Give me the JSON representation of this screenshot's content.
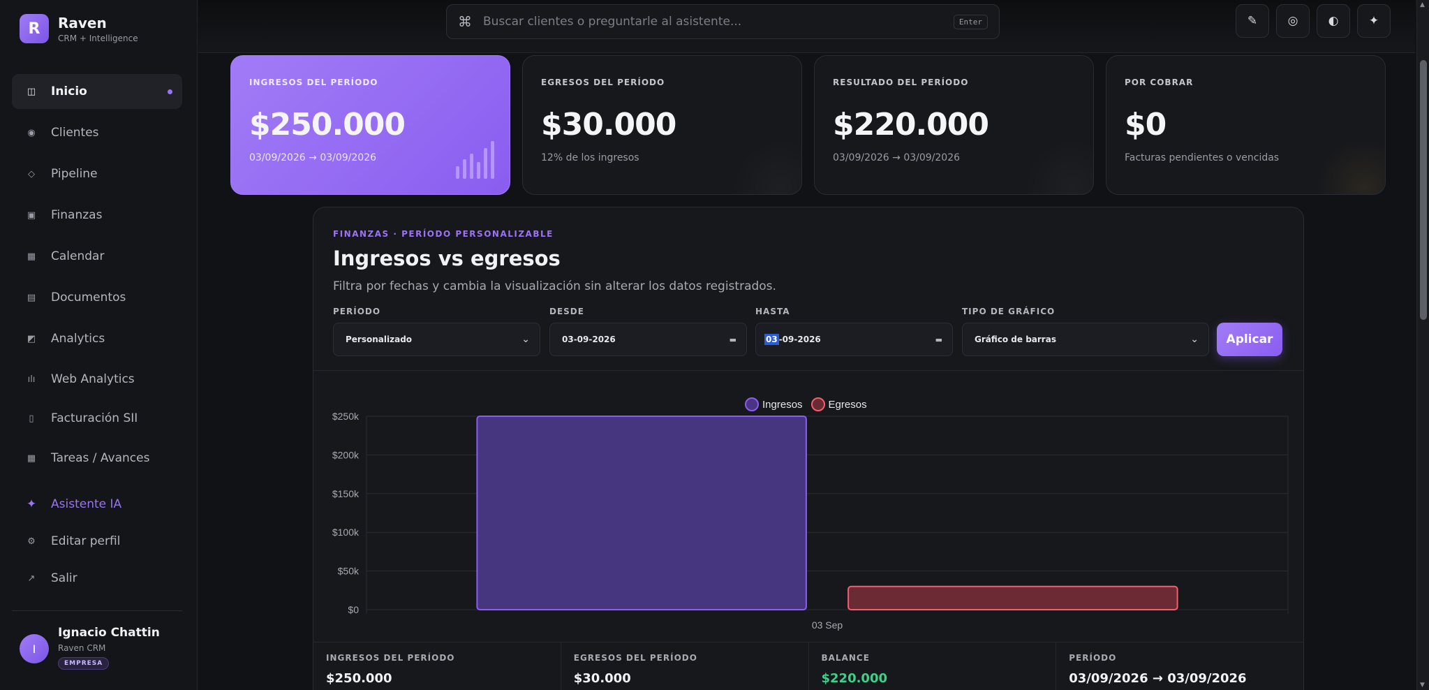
{
  "brand": {
    "initial": "R",
    "name": "Raven",
    "subtitle": "CRM + Intelligence"
  },
  "search": {
    "icon": "command-icon",
    "placeholder": "Buscar clientes o preguntarle al asistente...",
    "shortcut": "Enter"
  },
  "toolbar": {
    "buttons": [
      "edit-icon",
      "target-icon",
      "contrast-icon",
      "sparkle-icon"
    ]
  },
  "nav": {
    "items": [
      {
        "label": "Inicio",
        "icon": "layout-icon",
        "active": true
      },
      {
        "label": "Clientes",
        "icon": "users-icon"
      },
      {
        "label": "Pipeline",
        "icon": "diamond-icon"
      },
      {
        "label": "Finanzas",
        "icon": "wallet-icon"
      },
      {
        "label": "Calendar",
        "icon": "calendar-icon"
      },
      {
        "label": "Documentos",
        "icon": "documents-icon"
      },
      {
        "label": "Analytics",
        "icon": "analytics-icon"
      },
      {
        "label": "Web Analytics",
        "icon": "bar-chart-icon"
      },
      {
        "label": "Facturación SII",
        "icon": "invoice-icon"
      },
      {
        "label": "Tareas / Avances",
        "icon": "tasks-icon"
      }
    ],
    "assistant": "Asistente IA",
    "edit_profile": "Editar perfil",
    "logout": "Salir"
  },
  "user": {
    "initial": "I",
    "name": "Ignacio Chattin",
    "org": "Raven CRM",
    "badge": "EMPRESA"
  },
  "kpis": [
    {
      "label": "INGRESOS DEL PERÍODO",
      "value": "$250.000",
      "sub": "03/09/2026 → 03/09/2026"
    },
    {
      "label": "EGRESOS DEL PERÍODO",
      "value": "$30.000",
      "sub": "12% de los ingresos"
    },
    {
      "label": "RESULTADO DEL PERÍODO",
      "value": "$220.000",
      "sub": "03/09/2026 → 03/09/2026"
    },
    {
      "label": "POR COBRAR",
      "value": "$0",
      "sub": "Facturas pendientes o vencidas"
    }
  ],
  "finance": {
    "eyebrow": "FINANZAS · PERÍODO PERSONALIZABLE",
    "title": "Ingresos vs egresos",
    "subtitle": "Filtra por fechas y cambia la visualización sin alterar los datos registrados.",
    "filters": {
      "period_label": "PERÍODO",
      "period_value": "Personalizado",
      "from_label": "DESDE",
      "from_value": "03-09-2026",
      "to_label": "HASTA",
      "to_day": "03",
      "to_rest": "-09-2026",
      "type_label": "TIPO DE GRÁFICO",
      "type_value": "Gráfico de barras"
    },
    "apply": "Aplicar",
    "stats": [
      {
        "label": "INGRESOS DEL PERÍODO",
        "value": "$250.000"
      },
      {
        "label": "EGRESOS DEL PERÍODO",
        "value": "$30.000"
      },
      {
        "label": "BALANCE",
        "value": "$220.000"
      },
      {
        "label": "PERÍODO",
        "value": "03/09/2026 → 03/09/2026"
      }
    ]
  },
  "chart_data": {
    "type": "bar",
    "categories": [
      "03 Sep"
    ],
    "series": [
      {
        "name": "Ingresos",
        "values": [
          250000
        ],
        "color": "#8b5cf6"
      },
      {
        "name": "Egresos",
        "values": [
          30000
        ],
        "color": "#f25f6d"
      }
    ],
    "ylim": [
      0,
      250000
    ],
    "yticks": [
      "$0",
      "$50k",
      "$100k",
      "$150k",
      "$200k",
      "$250k"
    ],
    "grid": true,
    "legend": "top-center"
  }
}
